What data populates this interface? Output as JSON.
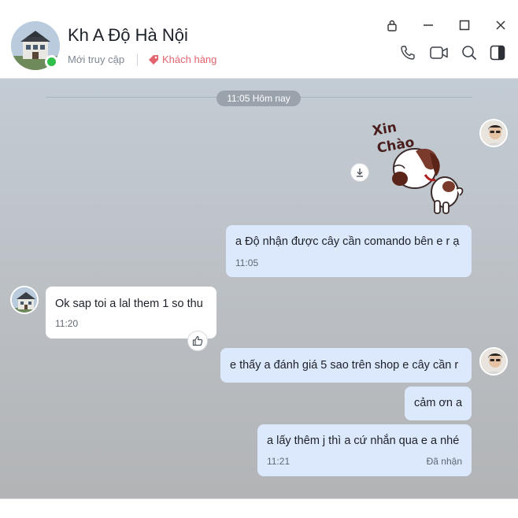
{
  "header": {
    "contact_name": "Kh A Độ Hà Nội",
    "status": "Mới truy cập",
    "tag": "Khách hàng"
  },
  "icons": {
    "lock": "lock-icon",
    "minimize": "minimize-icon",
    "maximize": "maximize-icon",
    "close": "close-icon",
    "call": "phone-icon",
    "video": "video-icon",
    "search": "search-icon",
    "panel": "panel-toggle-icon",
    "tag": "tag-icon",
    "download": "download-icon",
    "like": "thumbs-up-icon"
  },
  "colors": {
    "online": "#2fbf4a",
    "tag": "#e3646e",
    "my_bubble": "#dce8fb",
    "their_bubble": "#ffffff"
  },
  "chat": {
    "date_separator": "11:05 Hôm nay",
    "sticker_text": [
      "Xin",
      "Chào"
    ],
    "messages": [
      {
        "sender": "me",
        "text": "a Độ nhận được cây cần comando bên e r ạ",
        "time": "11:05"
      },
      {
        "sender": "contact",
        "text": "Ok sap toi a lal them 1 so thu",
        "time": "11:20"
      },
      {
        "sender": "me",
        "text": "e thấy a đánh giá 5 sao trên shop e cây cần r"
      },
      {
        "sender": "me",
        "text": "cảm ơn a"
      },
      {
        "sender": "me",
        "text": "a lấy thêm j thì a cứ nhắn qua e a nhé",
        "time": "11:21",
        "status": "Đã nhận"
      }
    ]
  }
}
